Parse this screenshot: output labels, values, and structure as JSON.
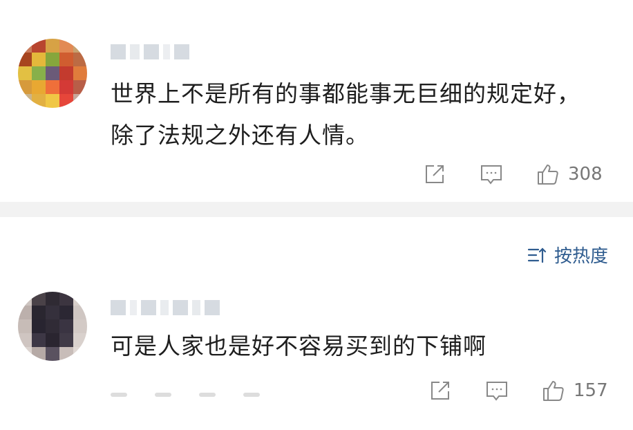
{
  "comments": [
    {
      "text": "世界上不是所有的事都能事无巨细的规定好，除了法规之外还有人情。",
      "likes": "308",
      "icons": {
        "share": "share-icon",
        "reply": "comment-icon",
        "like": "thumbs-up-icon"
      }
    },
    {
      "text": "可是人家也是好不容易买到的下铺啊",
      "likes": "157",
      "icons": {
        "share": "share-icon",
        "reply": "comment-icon",
        "like": "thumbs-up-icon"
      }
    }
  ],
  "sort": {
    "label": "按热度",
    "icon": "sort-icon"
  },
  "colors": {
    "accent": "#2f5c8f",
    "icon_gray": "#888888",
    "divider": "#f2f2f2"
  }
}
